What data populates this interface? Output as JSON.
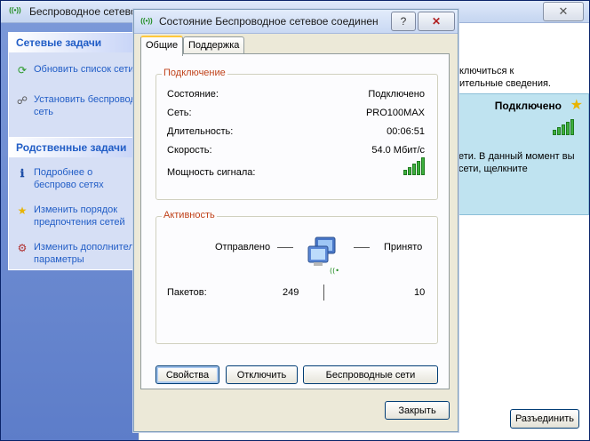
{
  "background": {
    "title": "Беспроводное сетевое",
    "close_glyph": "✕",
    "network_tasks": {
      "header": "Сетевые задачи",
      "items": [
        "Обновить список сети",
        "Установить беспровод сеть"
      ]
    },
    "related_tasks": {
      "header": "Родственные задачи",
      "items": [
        "Подробнее о беспрово сетях",
        "Изменить порядок предпочтения сетей",
        "Изменить дополнител параметры"
      ]
    },
    "text_line1": "ключиться к",
    "text_line2": "ительные сведения.",
    "network_card": {
      "status": "Подключено",
      "line1": "ети. В данный момент вы",
      "line2": "сети, щелкните"
    },
    "disconnect_button": "Разъединить"
  },
  "dialog": {
    "title": "Состояние Беспроводное сетевое соединен...",
    "help_glyph": "?",
    "close_glyph": "✕",
    "tabs": [
      {
        "label": "Общие",
        "active": true
      },
      {
        "label": "Поддержка",
        "active": false
      }
    ],
    "connection": {
      "title": "Подключение",
      "rows": [
        {
          "label": "Состояние:",
          "value": "Подключено"
        },
        {
          "label": "Сеть:",
          "value": "PRO100MAX"
        },
        {
          "label": "Длительность:",
          "value": "00:06:51"
        },
        {
          "label": "Скорость:",
          "value": "54.0 Мбит/с"
        },
        {
          "label": "Мощность сигнала:",
          "value": ""
        }
      ],
      "signal_bars": 5
    },
    "activity": {
      "title": "Активность",
      "sent_label": "Отправлено",
      "received_label": "Принято",
      "packets_label": "Пакетов:",
      "packets_sent": "249",
      "packets_received": "10"
    },
    "buttons": {
      "properties": "Свойства",
      "disconnect": "Отключить",
      "wireless_networks": "Беспроводные сети",
      "close": "Закрыть"
    }
  },
  "colors": {
    "group_title": "#c0421a",
    "task_link": "#215dc6",
    "signal": "#3db03d"
  }
}
